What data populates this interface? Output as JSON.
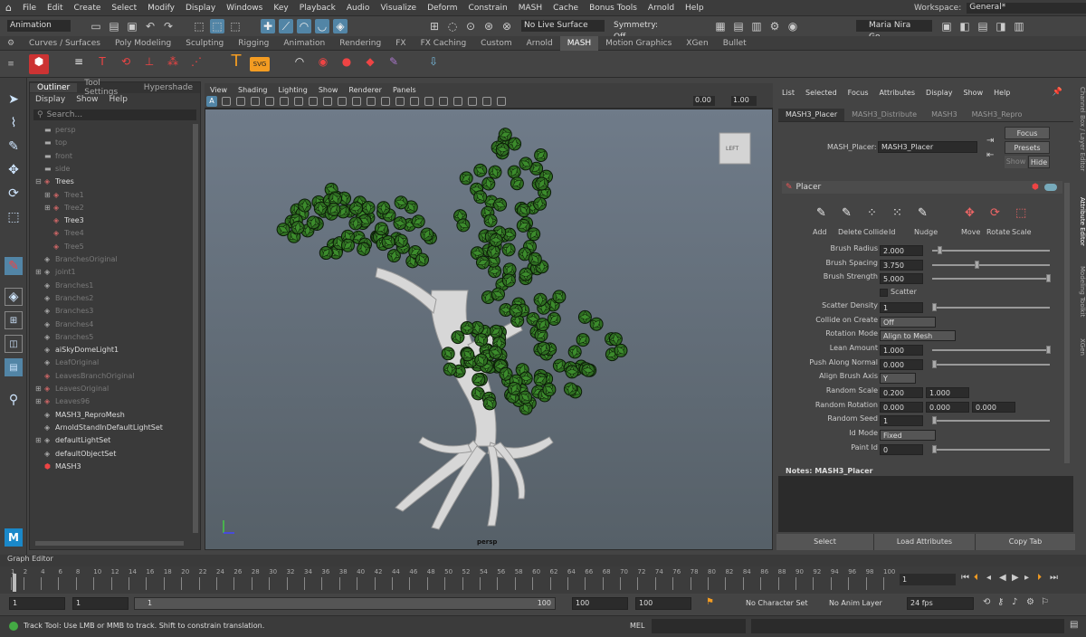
{
  "menubar": {
    "items": [
      "File",
      "Edit",
      "Create",
      "Select",
      "Modify",
      "Display",
      "Windows",
      "Key",
      "Playback",
      "Audio",
      "Visualize",
      "Deform",
      "Constrain",
      "MASH",
      "Cache",
      "Bonus Tools",
      "Arnold",
      "Help"
    ],
    "workspace_label": "Workspace:",
    "workspace_value": "General*"
  },
  "toolbar": {
    "mode": "Animation",
    "live_surface": "No Live Surface",
    "symmetry": "Symmetry: Off",
    "user": "Maria Nira Go..."
  },
  "shelf_tabs": [
    "Curves / Surfaces",
    "Poly Modeling",
    "Sculpting",
    "Rigging",
    "Animation",
    "Rendering",
    "FX",
    "FX Caching",
    "Custom",
    "Arnold",
    "MASH",
    "Motion Graphics",
    "XGen",
    "Bullet"
  ],
  "active_shelf": "MASH",
  "outliner": {
    "tabs": [
      "Outliner",
      "Tool Settings",
      "Hypershade"
    ],
    "menu": [
      "Display",
      "Show",
      "Help"
    ],
    "search_placeholder": "Search...",
    "items": [
      {
        "label": "persp",
        "dim": true,
        "indent": 0,
        "exp": ""
      },
      {
        "label": "top",
        "dim": true,
        "indent": 0,
        "exp": ""
      },
      {
        "label": "front",
        "dim": true,
        "indent": 0,
        "exp": ""
      },
      {
        "label": "side",
        "dim": true,
        "indent": 0,
        "exp": ""
      },
      {
        "label": "Trees",
        "dim": false,
        "indent": 0,
        "exp": "-"
      },
      {
        "label": "Tree1",
        "dim": true,
        "indent": 1,
        "exp": "+"
      },
      {
        "label": "Tree2",
        "dim": true,
        "indent": 1,
        "exp": "+"
      },
      {
        "label": "Tree3",
        "dim": false,
        "indent": 1,
        "exp": ""
      },
      {
        "label": "Tree4",
        "dim": true,
        "indent": 1,
        "exp": ""
      },
      {
        "label": "Tree5",
        "dim": true,
        "indent": 1,
        "exp": ""
      },
      {
        "label": "BranchesOriginal",
        "dim": true,
        "indent": 0,
        "exp": ""
      },
      {
        "label": "joint1",
        "dim": true,
        "indent": 0,
        "exp": "+"
      },
      {
        "label": "Branches1",
        "dim": true,
        "indent": 0,
        "exp": ""
      },
      {
        "label": "Branches2",
        "dim": true,
        "indent": 0,
        "exp": ""
      },
      {
        "label": "Branches3",
        "dim": true,
        "indent": 0,
        "exp": ""
      },
      {
        "label": "Branches4",
        "dim": true,
        "indent": 0,
        "exp": ""
      },
      {
        "label": "Branches5",
        "dim": true,
        "indent": 0,
        "exp": ""
      },
      {
        "label": "aiSkyDomeLight1",
        "dim": false,
        "indent": 0,
        "exp": ""
      },
      {
        "label": "LeafOriginal",
        "dim": true,
        "indent": 0,
        "exp": ""
      },
      {
        "label": "LeavesBranchOriginal",
        "dim": true,
        "indent": 0,
        "exp": ""
      },
      {
        "label": "LeavesOriginal",
        "dim": true,
        "indent": 0,
        "exp": "+"
      },
      {
        "label": "Leaves96",
        "dim": true,
        "indent": 0,
        "exp": "+"
      },
      {
        "label": "MASH3_ReproMesh",
        "dim": false,
        "indent": 0,
        "exp": ""
      },
      {
        "label": "ArnoldStandInDefaultLightSet",
        "dim": false,
        "indent": 0,
        "exp": ""
      },
      {
        "label": "defaultLightSet",
        "dim": false,
        "indent": 0,
        "exp": "+"
      },
      {
        "label": "defaultObjectSet",
        "dim": false,
        "indent": 0,
        "exp": ""
      },
      {
        "label": "MASH3",
        "dim": false,
        "indent": 0,
        "exp": ""
      }
    ]
  },
  "viewport": {
    "menu": [
      "View",
      "Shading",
      "Lighting",
      "Show",
      "Renderer",
      "Panels"
    ],
    "value1": "0.00",
    "value2": "1.00",
    "camera_label": "persp",
    "cube_label": "LEFT"
  },
  "attribute_editor": {
    "menu": [
      "List",
      "Selected",
      "Focus",
      "Attributes",
      "Display",
      "Show",
      "Help"
    ],
    "tabs": [
      "MASH3_Placer",
      "MASH3_Distribute",
      "MASH3",
      "MASH3_Repro"
    ],
    "node_label": "MASH_Placer:",
    "node_value": "MASH3_Placer",
    "focus_btn": "Focus",
    "presets_btn": "Presets",
    "show_btn": "Show",
    "hide_btn": "Hide",
    "section_title": "Placer",
    "tools": [
      "Add",
      "Delete",
      "Collide",
      "Id",
      "Nudge",
      "Move",
      "Rotate",
      "Scale"
    ],
    "attrs": [
      {
        "label": "Brush Radius",
        "v1": "2.000",
        "slider": 0.05
      },
      {
        "label": "Brush Spacing",
        "v1": "3.750",
        "slider": 0.37
      },
      {
        "label": "Brush Strength",
        "v1": "5.000",
        "slider": 1.0
      },
      {
        "label": "",
        "check": "Scatter"
      },
      {
        "label": "Scatter Density",
        "v1": "1",
        "slider": 0.0
      },
      {
        "label": "Collide on Create",
        "dropdown": "Off"
      },
      {
        "label": "Rotation Mode",
        "dropdown": "Align to Mesh"
      },
      {
        "label": "Lean Amount",
        "v1": "1.000",
        "slider": 1.0
      },
      {
        "label": "Push Along Normal",
        "v1": "0.000",
        "slider": 0.0
      },
      {
        "label": "Align Brush Axis",
        "dropdown": "Y"
      },
      {
        "label": "Random Scale",
        "v1": "0.200",
        "v2": "1.000"
      },
      {
        "label": "Random Rotation",
        "v1": "0.000",
        "v2": "0.000",
        "v3": "0.000"
      },
      {
        "label": "Random Seed",
        "v1": "1",
        "slider": 0.0
      },
      {
        "label": "Id Mode",
        "dropdown": "Fixed"
      },
      {
        "label": "Paint Id",
        "v1": "0",
        "slider": 0.0
      }
    ],
    "notes_label": "Notes:  MASH3_Placer",
    "bottom_buttons": [
      "Select",
      "Load Attributes",
      "Copy Tab"
    ],
    "side_tabs": [
      "Channel Box / Layer Editor",
      "Attribute Editor",
      "Modeling Toolkit",
      "XGen"
    ]
  },
  "graph_editor_label": "Graph Editor",
  "timeline": {
    "ticks": [
      "1",
      "2",
      "4",
      "6",
      "8",
      "10",
      "12",
      "14",
      "16",
      "18",
      "20",
      "22",
      "24",
      "26",
      "28",
      "30",
      "32",
      "34",
      "36",
      "38",
      "40",
      "42",
      "44",
      "46",
      "48",
      "50",
      "52",
      "54",
      "56",
      "58",
      "60",
      "62",
      "64",
      "66",
      "68",
      "70",
      "72",
      "74",
      "76",
      "78",
      "80",
      "82",
      "84",
      "86",
      "88",
      "90",
      "92",
      "94",
      "96",
      "98",
      "100"
    ],
    "current_frame": "1"
  },
  "range": {
    "start": "1",
    "start2": "1",
    "slider_start": "1",
    "slider_end": "100",
    "end": "100",
    "end2": "100",
    "character_set": "No Character Set",
    "anim_layer": "No Anim Layer",
    "fps": "24 fps"
  },
  "status": {
    "message": "Track Tool: Use LMB or MMB to track. Shift to constrain translation.",
    "mel_label": "MEL"
  },
  "colors": {
    "accent": "#5285a6",
    "leaf": "#3f8a2c",
    "trunk": "#d9d9d9"
  }
}
